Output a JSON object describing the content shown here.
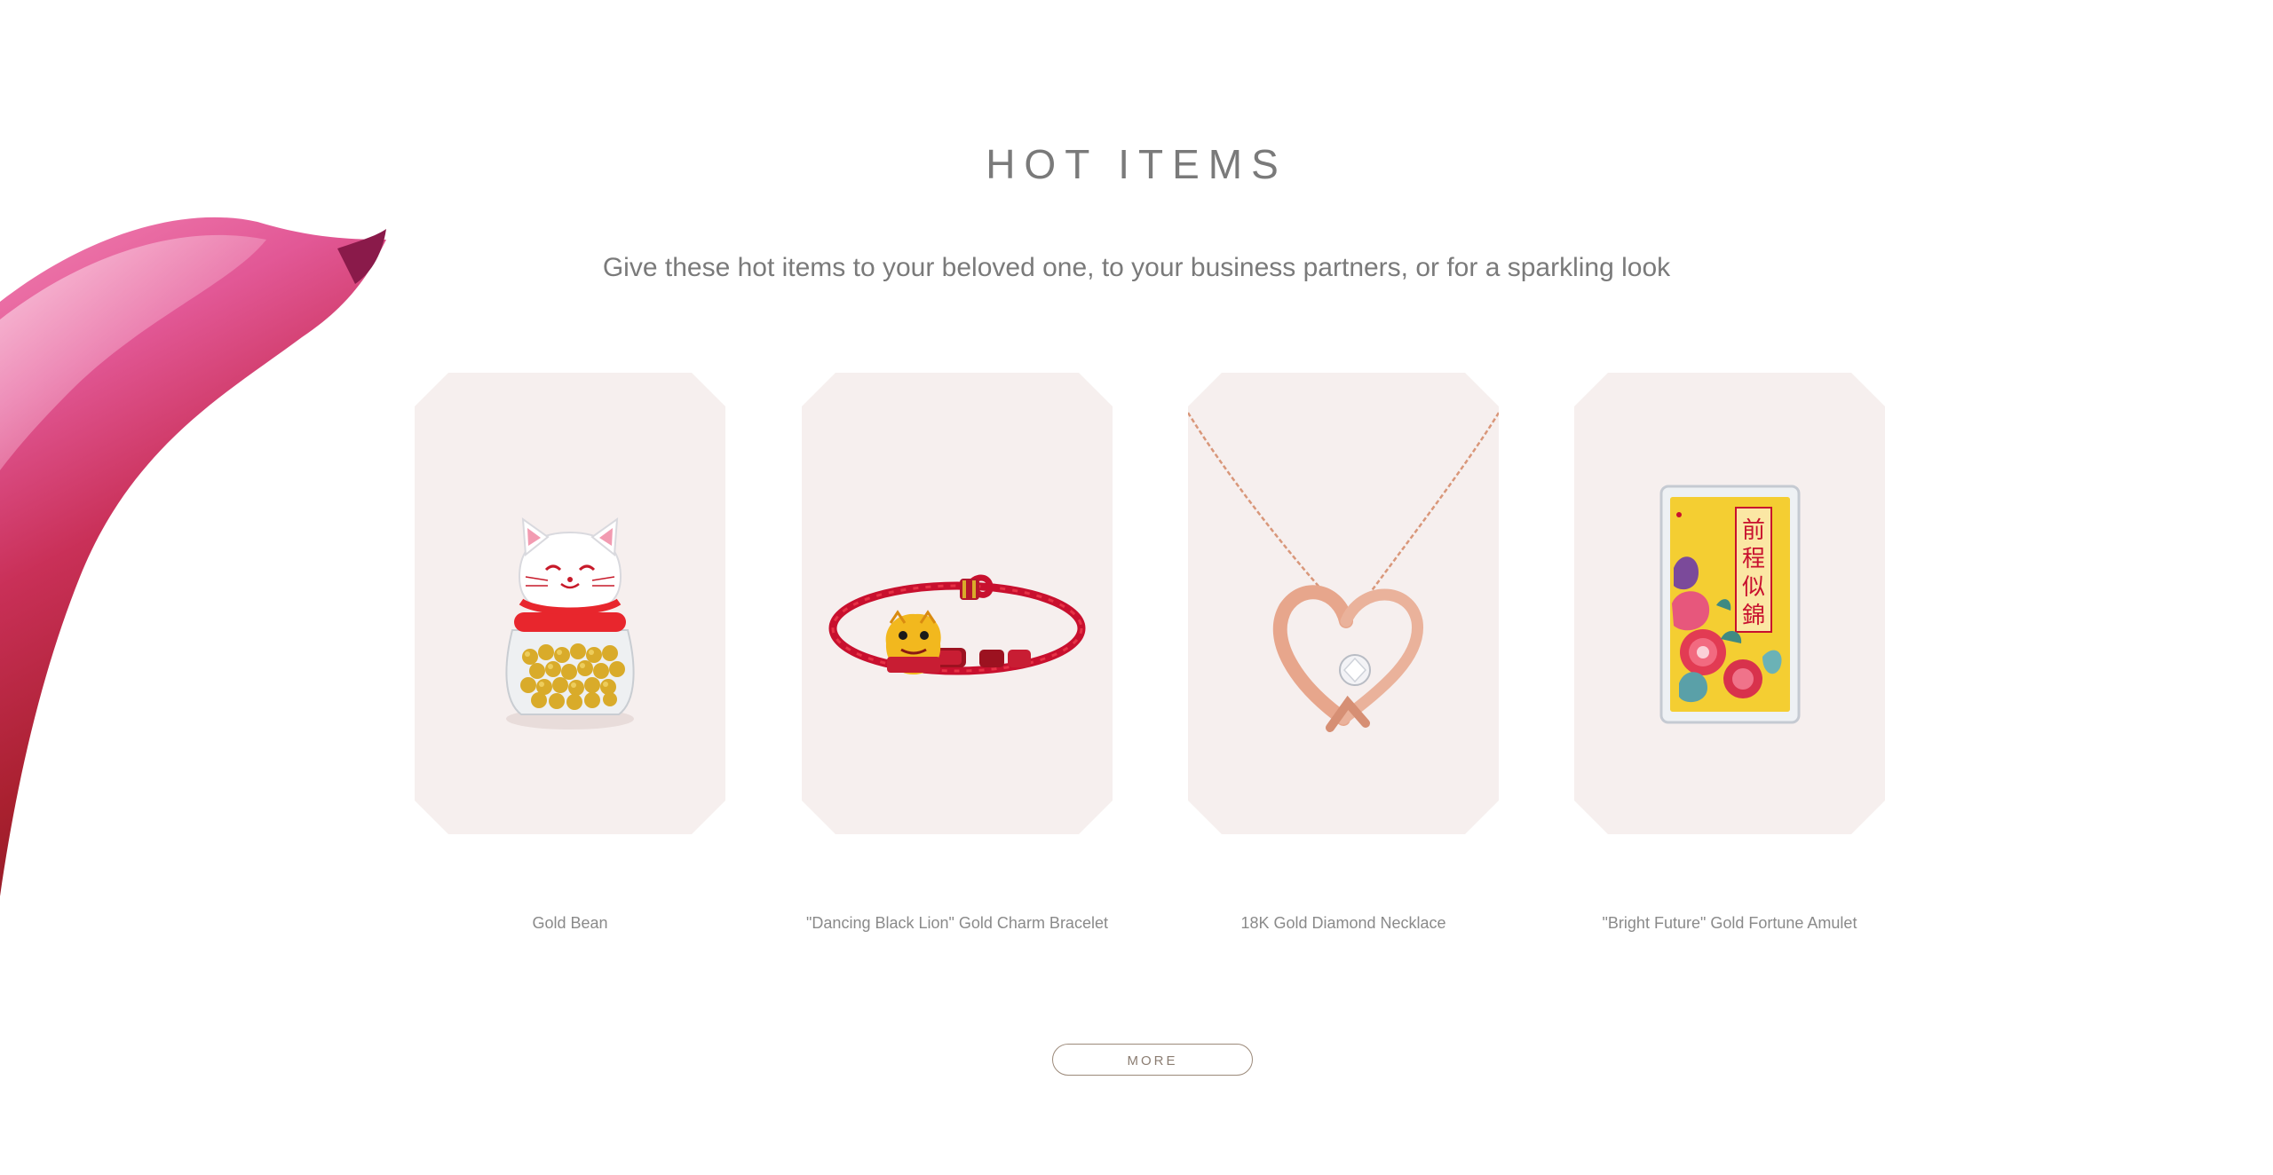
{
  "section": {
    "title": "HOT ITEMS",
    "subtitle": "Give these hot items to your beloved one, to your business partners, or for a sparkling look"
  },
  "products": [
    {
      "name": "Gold Bean",
      "icon": "lucky-cat-jar-icon"
    },
    {
      "name": "\"Dancing Black Lion\" Gold Charm Bracelet",
      "icon": "red-bracelet-icon"
    },
    {
      "name": "18K Gold Diamond Necklace",
      "icon": "heart-necklace-icon"
    },
    {
      "name": "\"Bright Future\" Gold Fortune Amulet",
      "icon": "gold-amulet-icon"
    }
  ],
  "amulet_text": "前程似錦",
  "more_button": {
    "label": "MORE"
  },
  "colors": {
    "card_background": "#f6efee",
    "title_text": "#7a7a7a",
    "button_border": "#9c8a7a",
    "petal_pink": "#e8659b",
    "petal_red": "#b52236"
  }
}
